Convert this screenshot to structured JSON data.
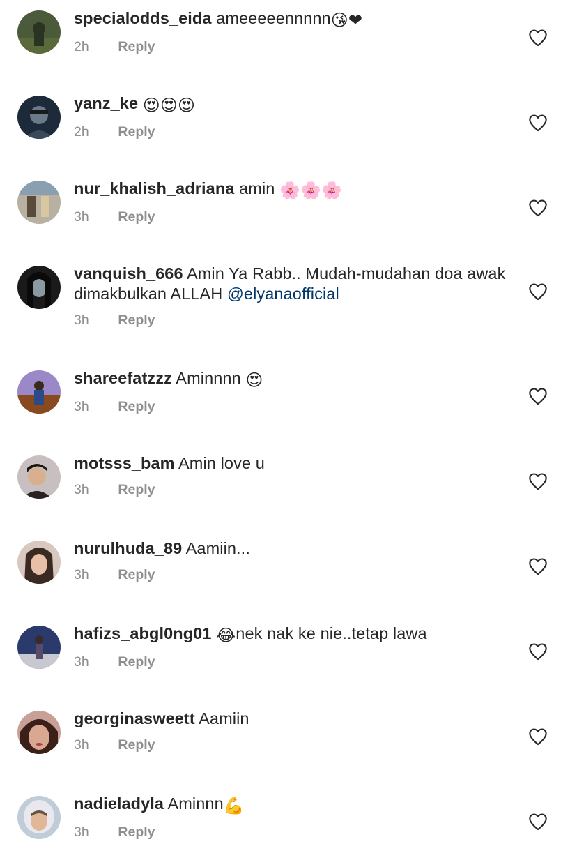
{
  "comments": [
    {
      "username": "specialodds_eida",
      "text": "ameeeeennnnn",
      "emoji": "😘❤",
      "time": "2h",
      "reply": "Reply",
      "avatar": {
        "bg": "#4a5a3a",
        "fg": "#2b3322"
      }
    },
    {
      "username": "yanz_ke",
      "text": "",
      "emoji": "😍😍😍",
      "time": "2h",
      "reply": "Reply",
      "avatar": {
        "bg": "#1c2a3a",
        "fg": "#6a7a8a"
      }
    },
    {
      "username": "nur_khalish_adriana",
      "text": "amin",
      "emoji": "🌸🌸🌸",
      "time": "3h",
      "reply": "Reply",
      "avatar": {
        "bg": "#b8b0a0",
        "fg": "#5a4a3a"
      }
    },
    {
      "username": "vanquish_666",
      "text": "Amin Ya Rabb.. Mudah-mudahan doa awak dimakbulkan ALLAH",
      "mention": "@elyanaofficial",
      "emoji": "",
      "time": "3h",
      "reply": "Reply",
      "avatar": {
        "bg": "#1a1a1a",
        "fg": "#8a9aa0"
      }
    },
    {
      "username": "shareefatzzz",
      "text": "Aminnnn",
      "emoji": "😍",
      "time": "3h",
      "reply": "Reply",
      "avatar": {
        "bg": "#9a88c8",
        "fg": "#8a4a20"
      }
    },
    {
      "username": "motsss_bam",
      "text": "Amin love u",
      "emoji": "",
      "time": "3h",
      "reply": "Reply",
      "avatar": {
        "bg": "#c8c0c0",
        "fg": "#2a2220"
      }
    },
    {
      "username": "nurulhuda_89",
      "text": "Aamiin...",
      "emoji": "",
      "time": "3h",
      "reply": "Reply",
      "avatar": {
        "bg": "#d8c8c0",
        "fg": "#3a2a22"
      }
    },
    {
      "username": "hafizs_abgl0ng01",
      "text": "nek nak ke nie..tetap lawa",
      "emoji": "😂",
      "emoji_first": true,
      "time": "3h",
      "reply": "Reply",
      "avatar": {
        "bg": "#2a3a6a",
        "fg": "#8a8aa0"
      }
    },
    {
      "username": "georginasweett",
      "text": "Aamiin",
      "emoji": "",
      "time": "3h",
      "reply": "Reply",
      "avatar": {
        "bg": "#c8a098",
        "fg": "#3a2018"
      }
    },
    {
      "username": "nadieladyla",
      "text": "Aminnn",
      "emoji": "💪",
      "time": "3h",
      "reply": "Reply",
      "avatar": {
        "bg": "#c0ccd8",
        "fg": "#6a5040"
      }
    }
  ],
  "colors": {
    "text": "#262626",
    "meta": "#8e8e8e",
    "mention": "#00376b",
    "heart_stroke": "#262626"
  },
  "icons": {
    "like": "heart-outline-icon"
  }
}
